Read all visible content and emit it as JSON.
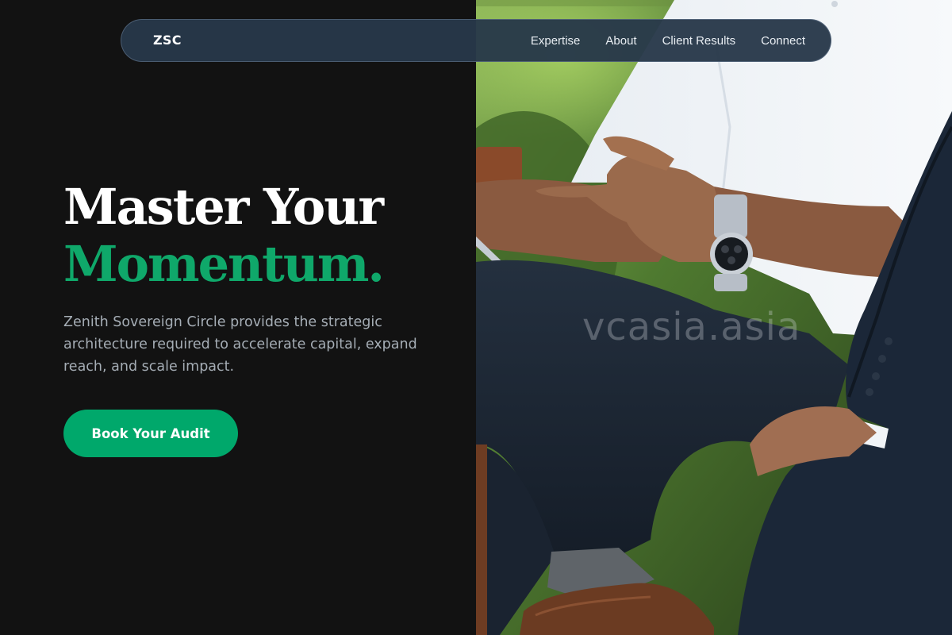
{
  "nav": {
    "brand": "ZSC",
    "links": [
      "Expertise",
      "About",
      "Client Results",
      "Connect"
    ]
  },
  "hero": {
    "title_line1": "Master Your",
    "title_line2": "Momentum.",
    "subtitle": "Zenith Sovereign Circle provides the strategic architecture required to accelerate capital, expand reach, and scale impact.",
    "cta_label": "Book Your Audit"
  },
  "image": {
    "watermark": "vcasia.asia",
    "subject": "business-meeting-photo"
  },
  "colors": {
    "background": "#121212",
    "accent": "#00a86b",
    "nav_background": "#28384a",
    "text_primary": "#ffffff",
    "text_muted": "#a5adb5"
  }
}
